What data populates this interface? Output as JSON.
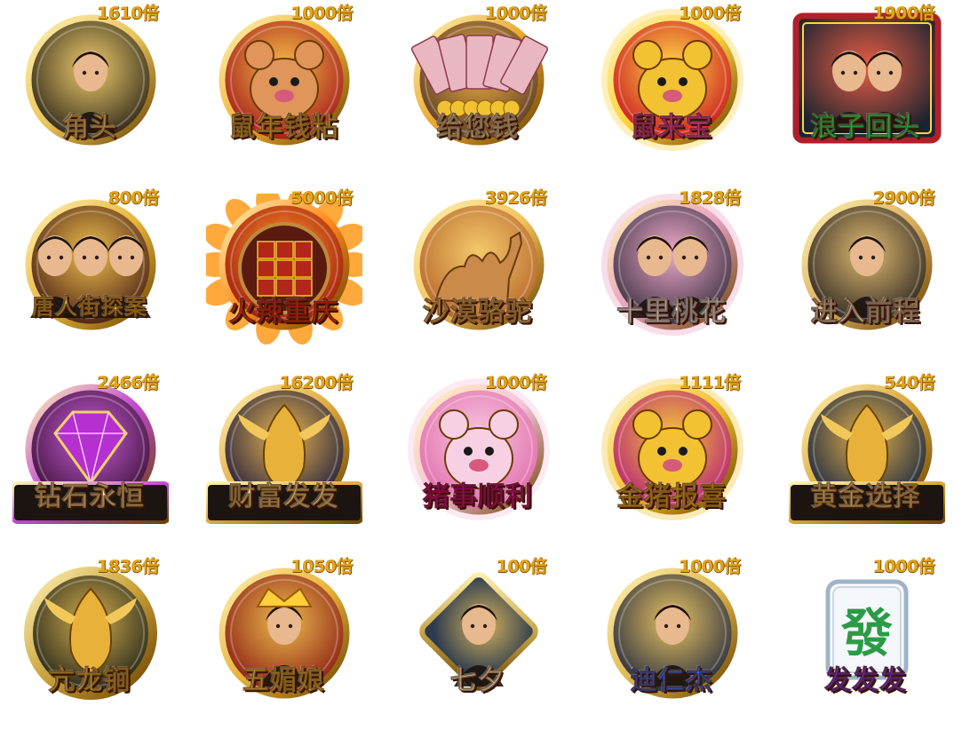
{
  "multiplier_suffix": "倍",
  "games": [
    {
      "name": "角头",
      "multiplier": "1610",
      "icon": "gangster-portrait-icon",
      "theme": "gold-ring",
      "bg": "#2a2418",
      "accent": "#e9c35a",
      "title_color": "#ffe27a"
    },
    {
      "name": "鼠年钱粘",
      "multiplier": "1000",
      "icon": "cartoon-rat-icon",
      "theme": "red-disc",
      "bg": "#a3181a",
      "accent": "#f2b233",
      "title_color": "#ffd24a"
    },
    {
      "name": "给您钱",
      "multiplier": "1000",
      "icon": "money-fan-icon",
      "theme": "gold-ring",
      "bg": "#5a3a28",
      "accent": "#e9a52e",
      "title_color": "#fff1b0"
    },
    {
      "name": "鼠来宝",
      "multiplier": "1000",
      "icon": "gold-rat-icon",
      "theme": "pink-glow",
      "bg": "#c9141f",
      "accent": "#ffd23a",
      "title_color": "#ff4fb3"
    },
    {
      "name": "浪子回头",
      "multiplier": "1900",
      "icon": "biker-duo-icon",
      "theme": "neon-frame",
      "bg": "#1b2430",
      "accent": "#e24a2f",
      "title_color": "#39ff6b"
    },
    {
      "name": "唐人街探案",
      "multiplier": "800",
      "icon": "detective-trio-icon",
      "theme": "dark-disc",
      "bg": "#4a1f14",
      "accent": "#e8b53a",
      "title_color": "#ffd24a"
    },
    {
      "name": "火辣重庆",
      "multiplier": "5000",
      "icon": "hotpot-fire-icon",
      "theme": "fire-ring",
      "bg": "#9b1a0e",
      "accent": "#ff8a1c",
      "title_color": "#ff3a1a"
    },
    {
      "name": "沙漠骆驼",
      "multiplier": "3926",
      "icon": "camel-icon",
      "theme": "gold-ring",
      "bg": "#b5632a",
      "accent": "#f2c35a",
      "title_color": "#ffcf6a"
    },
    {
      "name": "十里桃花",
      "multiplier": "1828",
      "icon": "couple-portrait-icon",
      "theme": "blossom",
      "bg": "#3a3040",
      "accent": "#e7a0c0",
      "title_color": "#ffffff"
    },
    {
      "name": "进入前程",
      "multiplier": "2900",
      "icon": "woman-portrait-icon",
      "theme": "gold-ring",
      "bg": "#2a2420",
      "accent": "#d9b060",
      "title_color": "#f3e2b8"
    },
    {
      "name": "钻石永恒",
      "multiplier": "2466",
      "icon": "diamond-icon",
      "theme": "plaque",
      "bg": "#3a1035",
      "accent": "#c04ad0",
      "title_color": "#ffe48a"
    },
    {
      "name": "财富发发",
      "multiplier": "16200",
      "icon": "phoenix-icon",
      "theme": "plaque",
      "bg": "#1d1b3a",
      "accent": "#e0a940",
      "title_color": "#ffe48a"
    },
    {
      "name": "猪事顺利",
      "multiplier": "1000",
      "icon": "paper-pig-icon",
      "theme": "lotus",
      "bg": "#e06aa8",
      "accent": "#f6c3dd",
      "title_color": "#e0138c"
    },
    {
      "name": "金猪报喜",
      "multiplier": "1111",
      "icon": "golden-pig-icon",
      "theme": "pink-glow",
      "bg": "#b61c79",
      "accent": "#f3c22e",
      "title_color": "#ffc933"
    },
    {
      "name": "黄金选择",
      "multiplier": "540",
      "icon": "golden-dragon-icon",
      "theme": "plaque",
      "bg": "#14233f",
      "accent": "#d9a53a",
      "title_color": "#ffe48a"
    },
    {
      "name": "亢龙锏",
      "multiplier": "1836",
      "icon": "dragon-mace-icon",
      "theme": "metal-ring",
      "bg": "#1e2218",
      "accent": "#c9a03a",
      "title_color": "#ffd24a"
    },
    {
      "name": "五媚娘",
      "multiplier": "1050",
      "icon": "empress-icon",
      "theme": "gold-ring",
      "bg": "#8a1a12",
      "accent": "#e8b23a",
      "title_color": "#ffd24a"
    },
    {
      "name": "七夕",
      "multiplier": "100",
      "icon": "cowherd-boy-icon",
      "theme": "diamond-frame",
      "bg": "#2c3b4f",
      "accent": "#c8a64a",
      "title_color": "#fff4c8"
    },
    {
      "name": "迪仁杰",
      "multiplier": "1000",
      "icon": "detective-swordsman-icon",
      "theme": "gold-ring",
      "bg": "#232a3e",
      "accent": "#e0b850",
      "title_color": "#4a76ff"
    },
    {
      "name": "发发发",
      "multiplier": "1000",
      "icon": "mahjong-tile-icon",
      "theme": "tile",
      "bg": "#e9eef4",
      "accent": "#2a9c46",
      "title_color": "#8a3ad8"
    }
  ]
}
